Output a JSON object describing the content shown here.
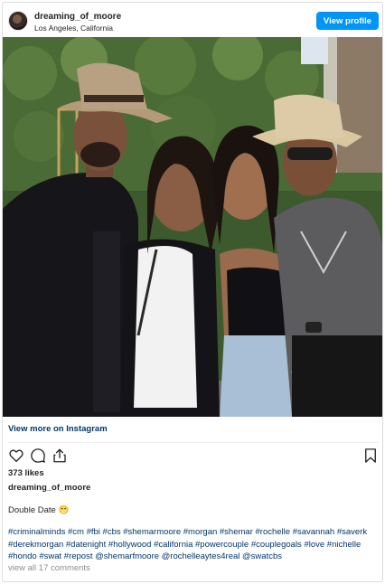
{
  "header": {
    "username": "dreaming_of_moore",
    "location": "Los Angeles, California",
    "view_profile_label": "View profile"
  },
  "photo": {
    "subject": "Two couples posing at an outdoor event in front of a green hedge"
  },
  "links": {
    "view_more_label": "View more on Instagram"
  },
  "actions": {
    "icons": [
      "heart-icon",
      "comment-icon",
      "share-icon",
      "bookmark-icon"
    ]
  },
  "stats": {
    "likes": "373 likes"
  },
  "caption": {
    "username": "dreaming_of_moore",
    "text": "Double Date 😁",
    "hashtags": "#criminalminds #cm #fbi #cbs #shemarmoore #morgan #shemar #rochelle #savannah #saverk #derekmorgan #datenight #hollywood #california #powercouple #couplegoals #love #nichelle #hondo #swat #repost @shemarfmoore @rochelleaytes4real @swatcbs"
  },
  "comments": {
    "view_all_label": "view all 17 comments"
  },
  "colors": {
    "accent": "#0095f6",
    "link": "#00376b",
    "muted": "#8e8e8e"
  }
}
